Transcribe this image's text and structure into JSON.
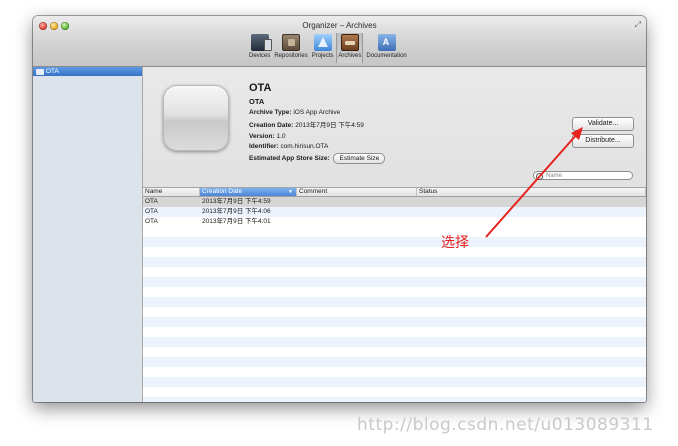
{
  "window": {
    "title": "Organizer – Archives"
  },
  "toolbar": {
    "items": [
      {
        "label": "Devices",
        "icon": "devices-icon"
      },
      {
        "label": "Repositories",
        "icon": "repositories-icon"
      },
      {
        "label": "Projects",
        "icon": "projects-icon"
      },
      {
        "label": "Archives",
        "icon": "archives-icon",
        "active": true
      },
      {
        "label": "Documentation",
        "icon": "documentation-icon"
      }
    ]
  },
  "sidebar": {
    "items": [
      {
        "label": "OTA",
        "selected": true
      }
    ]
  },
  "detail": {
    "title": "OTA",
    "subtitle": "OTA",
    "archive_type_label": "Archive Type:",
    "archive_type": "iOS App Archive",
    "creation_date_label": "Creation Date:",
    "creation_date": "2013年7月9日 下午4:59",
    "version_label": "Version:",
    "version": "1.0",
    "identifier_label": "Identifier:",
    "identifier": "com.hirisun.OTA",
    "store_size_label": "Estimated App Store Size:",
    "estimate_button": "Estimate Size",
    "validate_button": "Validate...",
    "distribute_button": "Distribute...",
    "search_placeholder": "Name"
  },
  "table": {
    "headers": [
      "Name",
      "Creation Date",
      "Comment",
      "Status"
    ],
    "rows": [
      {
        "name": "OTA",
        "date": "2013年7月9日 下午4:59",
        "comment": "",
        "status": "",
        "selected": true
      },
      {
        "name": "OTA",
        "date": "2013年7月9日 下午4:06",
        "comment": "",
        "status": ""
      },
      {
        "name": "OTA",
        "date": "2013年7月9日 下午4:01",
        "comment": "",
        "status": ""
      }
    ]
  },
  "annotation": {
    "label": "选择",
    "color": "#e8221c"
  },
  "watermark": "http://blog.csdn.net/u013089311",
  "colors": {
    "selection": "#3872c7",
    "stripe": "#edf3fc",
    "annotation": "#e8221c"
  }
}
